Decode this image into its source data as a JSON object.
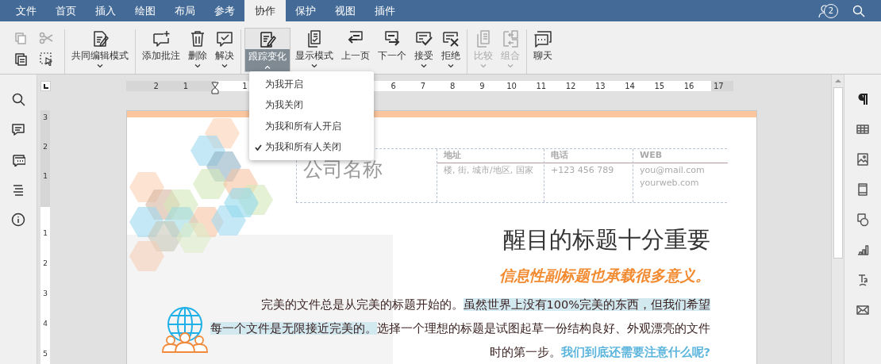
{
  "tabs": [
    {
      "label": "文件",
      "selected": false
    },
    {
      "label": "首页",
      "selected": false
    },
    {
      "label": "插入",
      "selected": false
    },
    {
      "label": "绘图",
      "selected": false
    },
    {
      "label": "布局",
      "selected": false
    },
    {
      "label": "参考",
      "selected": false
    },
    {
      "label": "协作",
      "selected": true
    },
    {
      "label": "保护",
      "selected": false
    },
    {
      "label": "视图",
      "selected": false
    },
    {
      "label": "插件",
      "selected": false
    }
  ],
  "collaborators": {
    "count": "2"
  },
  "toolbar": {
    "small_tools": [
      {
        "disabled": true
      },
      {
        "disabled": true
      },
      {
        "disabled": false
      },
      {
        "disabled": false
      }
    ],
    "groups": [
      [
        {
          "label": "共同编辑模式",
          "dropdown": true,
          "expanded": false,
          "disabled": false
        }
      ],
      [
        {
          "label": "添加批注",
          "dropdown": false,
          "expanded": false,
          "disabled": false
        },
        {
          "label": "删除",
          "dropdown": true,
          "expanded": false,
          "disabled": false
        },
        {
          "label": "解决",
          "dropdown": true,
          "expanded": false,
          "disabled": false
        }
      ],
      [
        {
          "label": "跟踪变化",
          "dropdown": true,
          "expanded": true,
          "disabled": false
        },
        {
          "label": "显示模式",
          "dropdown": true,
          "expanded": false,
          "disabled": false
        },
        {
          "label": "上一页",
          "dropdown": false,
          "expanded": false,
          "disabled": false
        },
        {
          "label": "下一个",
          "dropdown": false,
          "expanded": false,
          "disabled": false
        },
        {
          "label": "接受",
          "dropdown": true,
          "expanded": false,
          "disabled": false
        },
        {
          "label": "拒绝",
          "dropdown": true,
          "expanded": false,
          "disabled": false
        }
      ],
      [
        {
          "label": "比较",
          "dropdown": true,
          "expanded": false,
          "disabled": true
        },
        {
          "label": "组合",
          "dropdown": true,
          "expanded": false,
          "disabled": true
        }
      ],
      [
        {
          "label": "聊天",
          "dropdown": false,
          "expanded": false,
          "disabled": false
        }
      ]
    ]
  },
  "menu": {
    "items": [
      {
        "label": "为我开启",
        "checked": false
      },
      {
        "label": "为我关闭",
        "checked": false
      },
      {
        "label": "为我和所有人开启",
        "checked": false
      },
      {
        "label": "为我和所有人关闭",
        "checked": true
      }
    ]
  },
  "ruler": {
    "left_labels": [
      "2",
      "1"
    ],
    "right_labels": [
      "1"
    ],
    "labels_after_menu": [
      "6",
      "7",
      "8",
      "9",
      "10",
      "11",
      "12",
      "13",
      "14",
      "15",
      "16",
      "17"
    ],
    "vertical_top_labels": [
      "3",
      "2",
      "1"
    ],
    "vertical_labels": [
      "1",
      "2",
      "3",
      "4",
      "5"
    ]
  },
  "document": {
    "company": "公司名称",
    "contact_columns": [
      {
        "heading": "地址",
        "lines": [
          "楼, 街, 城市/地区, 国家"
        ]
      },
      {
        "heading": "电话",
        "lines": [
          "+123 456 789"
        ]
      },
      {
        "heading": "WEB",
        "lines": [
          "you@mail.com",
          "yourweb.com"
        ]
      }
    ],
    "title": "醒目的标题十分重要",
    "subtitle": "信息性副标题也承载很多意义。",
    "body_lines": [
      [
        {
          "text": "完美的文件总是从完美的标题开始的。",
          "kind": "plain"
        },
        {
          "text": "虽然世界上没有100%完美的东西，但我们希望",
          "kind": "highlight"
        }
      ],
      [
        {
          "text": "每一个文件是无限接近完美的。",
          "kind": "highlight"
        },
        {
          "text": "选择一个理想的标题是试图起草一份结构良好、外观漂亮的文件",
          "kind": "plain"
        }
      ],
      [
        {
          "text": "时的第一步。",
          "kind": "plain"
        },
        {
          "text": "我们到底还需要注意什么呢?",
          "kind": "accent"
        }
      ]
    ]
  }
}
